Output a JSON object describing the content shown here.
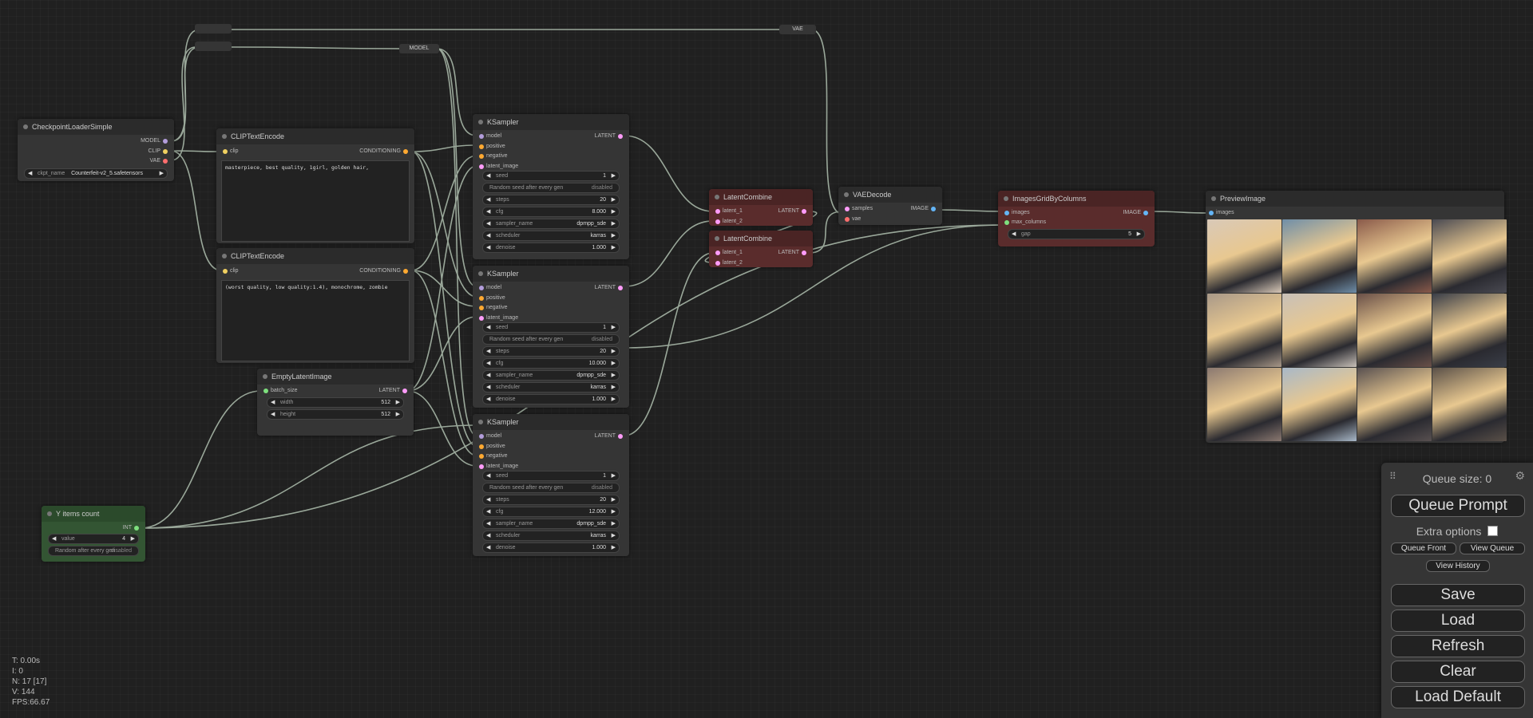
{
  "canvas": {
    "reroutes": {
      "model_label": "MODEL",
      "vae_label": "VAE"
    }
  },
  "nodes": {
    "checkpoint": {
      "title": "CheckpointLoaderSimple",
      "outputs": [
        "MODEL",
        "CLIP",
        "VAE"
      ],
      "ckpt_label": "ckpt_name",
      "ckpt_value": "Counterfeit-v2_5.safetensors"
    },
    "clip_pos": {
      "title": "CLIPTextEncode",
      "input": "clip",
      "output": "CONDITIONING",
      "text": "masterpiece, best quality, 1girl, golden hair,"
    },
    "clip_neg": {
      "title": "CLIPTextEncode",
      "input": "clip",
      "output": "CONDITIONING",
      "text": "(worst quality, low quality:1.4), monochrome, zombie"
    },
    "empty_latent": {
      "title": "EmptyLatentImage",
      "input": "batch_size",
      "output": "LATENT",
      "width_label": "width",
      "width_value": "512",
      "height_label": "height",
      "height_value": "512"
    },
    "y_count": {
      "title": "Y items count",
      "output": "INT",
      "value_label": "value",
      "value_value": "4",
      "random_label": "Random after every gen",
      "random_value": "disabled"
    },
    "ksamplers": [
      {
        "title": "KSampler",
        "inputs": [
          "model",
          "positive",
          "negative",
          "latent_image"
        ],
        "output": "LATENT",
        "seed": "1",
        "seed_mode": "Random seed after every gen",
        "seed_mode_value": "disabled",
        "steps": "20",
        "cfg": "8.000",
        "sampler_name": "dpmpp_sde",
        "scheduler": "karras",
        "denoise": "1.000"
      },
      {
        "title": "KSampler",
        "inputs": [
          "model",
          "positive",
          "negative",
          "latent_image"
        ],
        "output": "LATENT",
        "seed": "1",
        "seed_mode": "Random seed after every gen",
        "seed_mode_value": "disabled",
        "steps": "20",
        "cfg": "10.000",
        "sampler_name": "dpmpp_sde",
        "scheduler": "karras",
        "denoise": "1.000"
      },
      {
        "title": "KSampler",
        "inputs": [
          "model",
          "positive",
          "negative",
          "latent_image"
        ],
        "output": "LATENT",
        "seed": "1",
        "seed_mode": "Random seed after every gen",
        "seed_mode_value": "disabled",
        "steps": "20",
        "cfg": "12.000",
        "sampler_name": "dpmpp_sde",
        "scheduler": "karras",
        "denoise": "1.000"
      }
    ],
    "widget_labels": {
      "seed": "seed",
      "steps": "steps",
      "cfg": "cfg",
      "sampler_name": "sampler_name",
      "scheduler": "scheduler",
      "denoise": "denoise"
    },
    "latent_combine_1": {
      "title": "LatentCombine",
      "inputs": [
        "latent_1",
        "latent_2"
      ],
      "output": "LATENT"
    },
    "latent_combine_2": {
      "title": "LatentCombine",
      "inputs": [
        "latent_1",
        "latent_2"
      ],
      "output": "LATENT"
    },
    "vae_decode": {
      "title": "VAEDecode",
      "inputs": [
        "samples",
        "vae"
      ],
      "output": "IMAGE"
    },
    "grid": {
      "title": "ImagesGridByColumns",
      "inputs": [
        "images",
        "max_columns"
      ],
      "output": "IMAGE",
      "gap_label": "gap",
      "gap_value": "5"
    },
    "preview": {
      "title": "PreviewImage",
      "input": "images",
      "thumb_colors": [
        "#d9c9b8",
        "#6f8ea8",
        "#8a5a4a",
        "#4a4a52",
        "#a89888",
        "#c8c0b8",
        "#6a5048",
        "#3a3e48",
        "#8a7870",
        "#a8b8c8",
        "#585050",
        "#5a5048"
      ]
    }
  },
  "menu": {
    "queue_size": "Queue size: 0",
    "queue_prompt": "Queue Prompt",
    "extra_options": "Extra options",
    "queue_front": "Queue Front",
    "view_queue": "View Queue",
    "view_history": "View History",
    "save": "Save",
    "load": "Load",
    "refresh": "Refresh",
    "clear": "Clear",
    "load_default": "Load Default"
  },
  "stats": {
    "t": "T: 0.00s",
    "i": "I: 0",
    "n": "N: 17 [17]",
    "v": "V: 144",
    "fps": "FPS:66.67"
  },
  "colors": {
    "model": "#b39ddb",
    "clip": "#f0d060",
    "vae": "#ff6e6e",
    "conditioning": "#ffa931",
    "latent": "#ff9cf9",
    "image": "#64b5f6",
    "int": "#7ee07e",
    "wire": "#9aa89a"
  }
}
